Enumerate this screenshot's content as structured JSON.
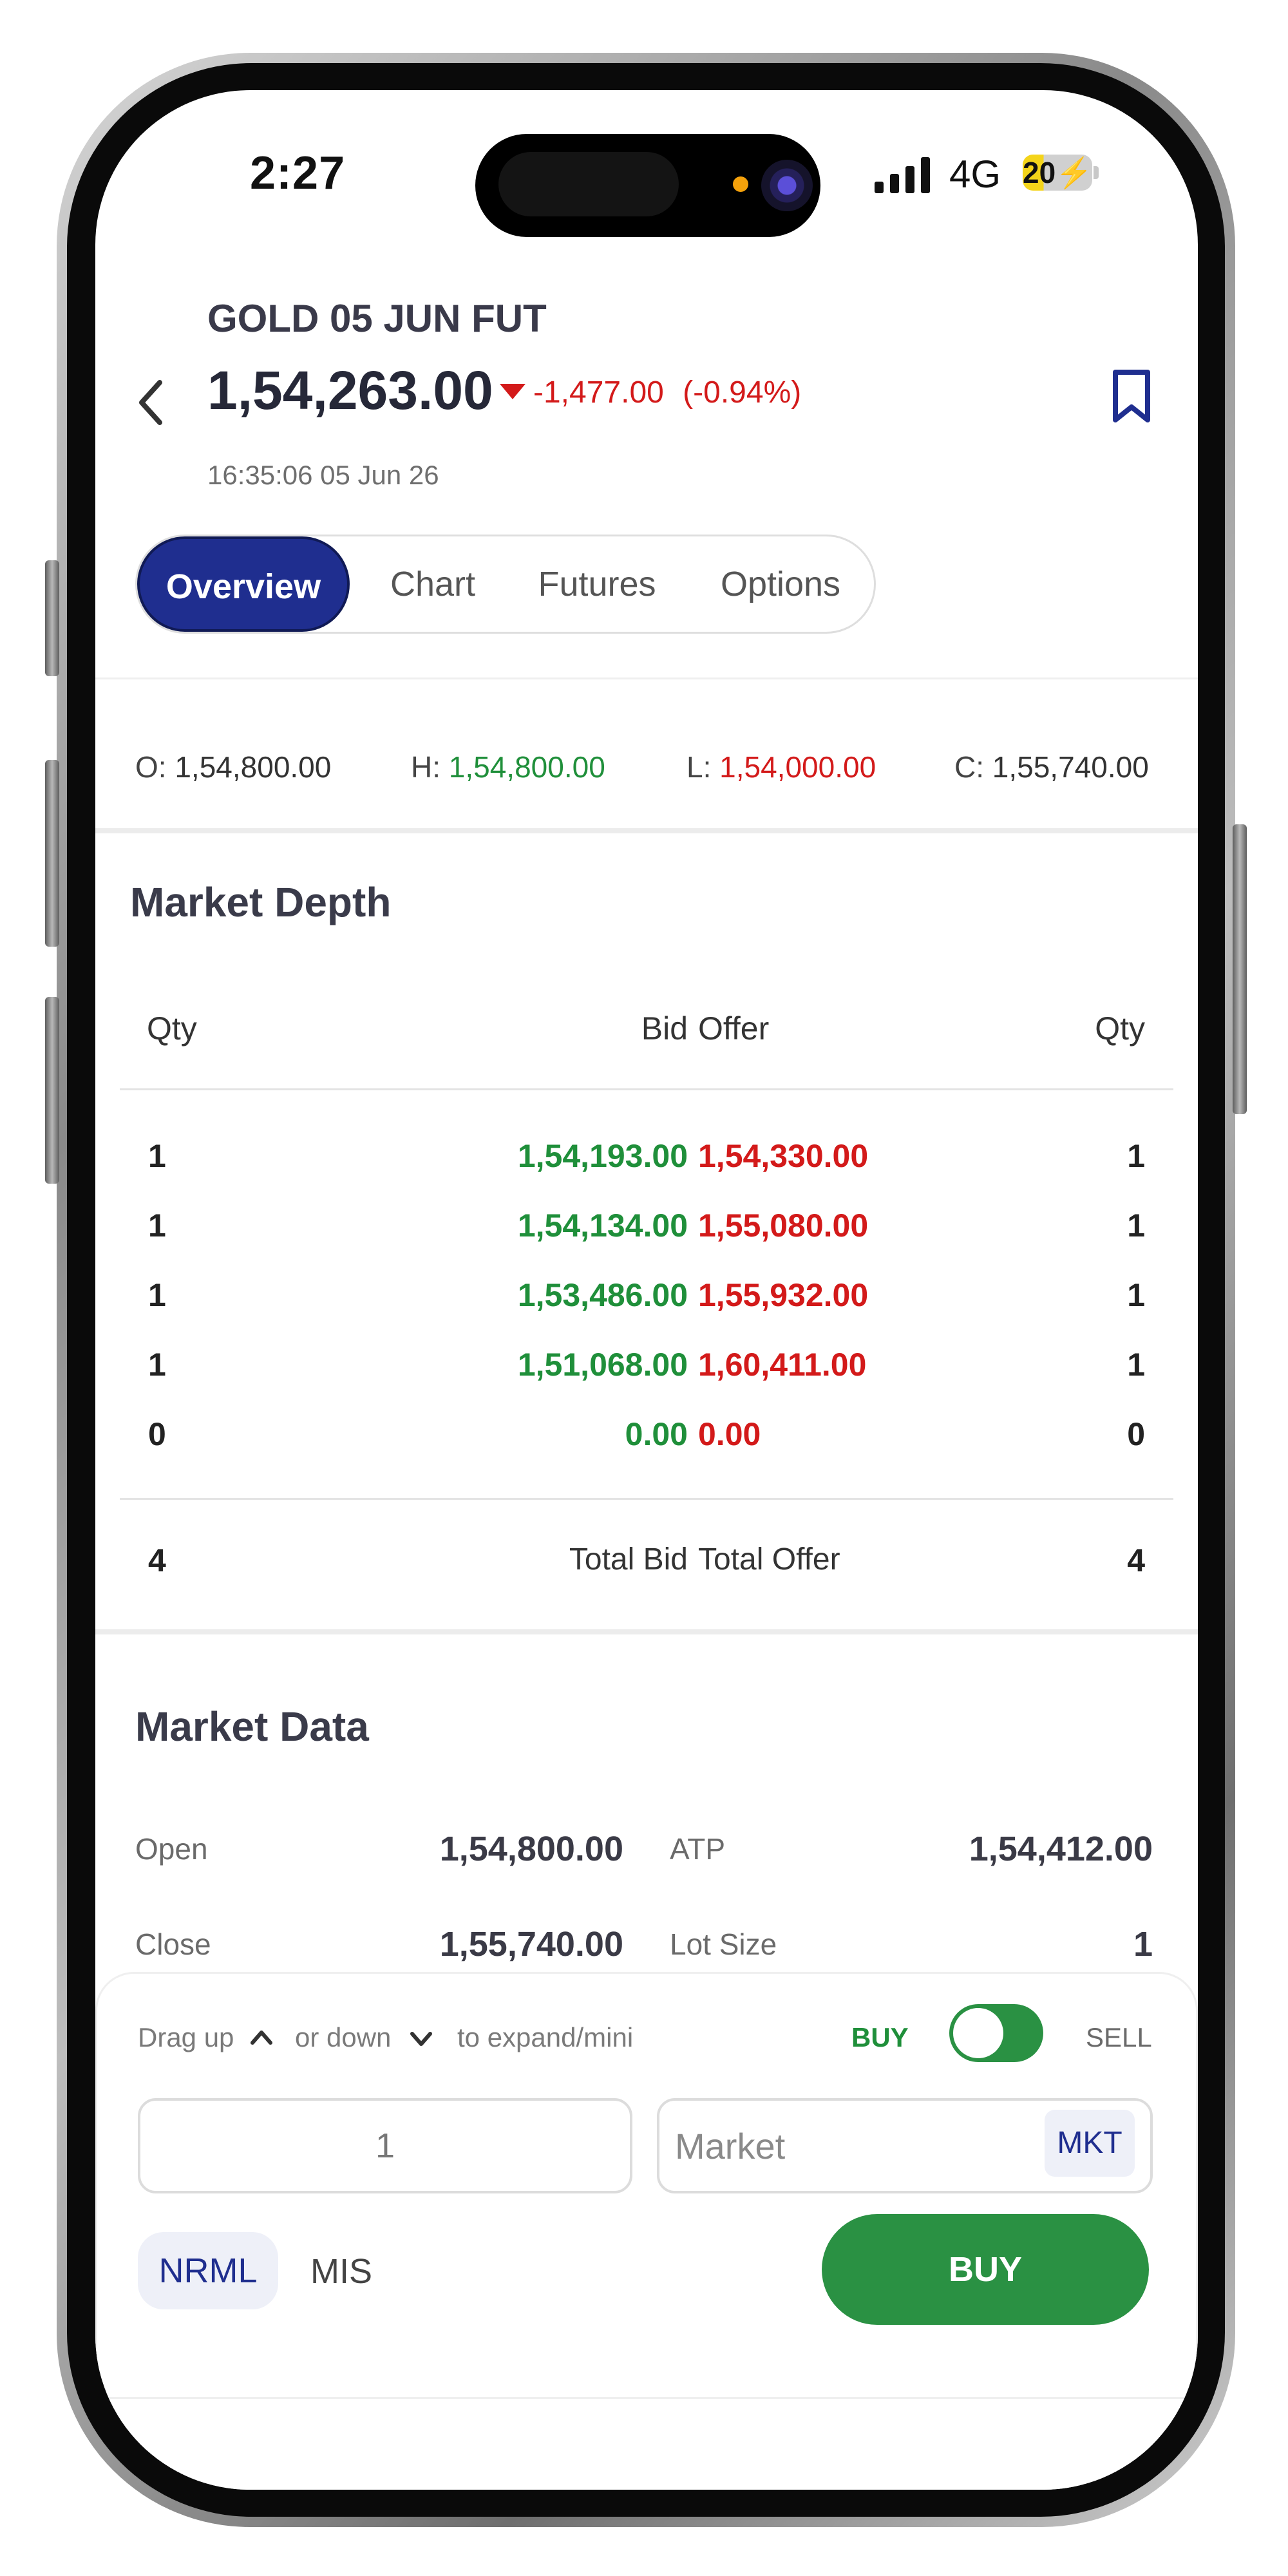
{
  "status_bar": {
    "time": "2:27",
    "network": "4G",
    "battery": "20"
  },
  "header": {
    "symbol": "GOLD 05 JUN FUT",
    "price": "1,54,263.00",
    "change": "-1,477.00",
    "change_pct": "(-0.94%)",
    "timestamp": "16:35:06 05 Jun 26"
  },
  "tabs": [
    {
      "label": "Overview",
      "active": true
    },
    {
      "label": "Chart",
      "active": false
    },
    {
      "label": "Futures",
      "active": false
    },
    {
      "label": "Options",
      "active": false
    }
  ],
  "ohlc": {
    "open_label": "O:",
    "open": "1,54,800.00",
    "high_label": "H:",
    "high": "1,54,800.00",
    "low_label": "L:",
    "low": "1,54,000.00",
    "close_label": "C:",
    "close": "1,55,740.00"
  },
  "market_depth": {
    "title": "Market Depth",
    "headers": [
      "Qty",
      "Bid",
      "Offer",
      "Qty"
    ],
    "rows": [
      {
        "bid_qty": "1",
        "bid": "1,54,193.00",
        "offer": "1,54,330.00",
        "offer_qty": "1"
      },
      {
        "bid_qty": "1",
        "bid": "1,54,134.00",
        "offer": "1,55,080.00",
        "offer_qty": "1"
      },
      {
        "bid_qty": "1",
        "bid": "1,53,486.00",
        "offer": "1,55,932.00",
        "offer_qty": "1"
      },
      {
        "bid_qty": "1",
        "bid": "1,51,068.00",
        "offer": "1,60,411.00",
        "offer_qty": "1"
      },
      {
        "bid_qty": "0",
        "bid": "0.00",
        "offer": "0.00",
        "offer_qty": "0"
      }
    ],
    "total_bid_qty": "4",
    "total_bid_label": "Total Bid",
    "total_offer_label": "Total Offer",
    "total_offer_qty": "4"
  },
  "market_data": {
    "title": "Market Data",
    "items": [
      {
        "label": "Open",
        "value": "1,54,800.00"
      },
      {
        "label": "ATP",
        "value": "1,54,412.00"
      },
      {
        "label": "Close",
        "value": "1,55,740.00"
      },
      {
        "label": "Lot Size",
        "value": "1"
      }
    ]
  },
  "order_panel": {
    "drag_text_1": "Drag up",
    "drag_text_2": "or down",
    "drag_text_3": "to expand/mini",
    "buy_label": "BUY",
    "sell_label": "SELL",
    "toggle_side": "buy",
    "quantity_value": "1",
    "price_placeholder": "Market",
    "market_badge": "MKT",
    "product_nrml": "NRML",
    "product_mis": "MIS",
    "submit_label": "BUY"
  },
  "colors": {
    "accent": "#1f2e8f",
    "positive": "#1f8f3a",
    "negative": "#d31a1a",
    "buy_button": "#2a9143"
  },
  "icons": [
    "back-icon",
    "bookmark-icon",
    "signal-icon",
    "battery-icon",
    "chevron-up-icon",
    "chevron-down-icon",
    "price-down-triangle-icon"
  ]
}
